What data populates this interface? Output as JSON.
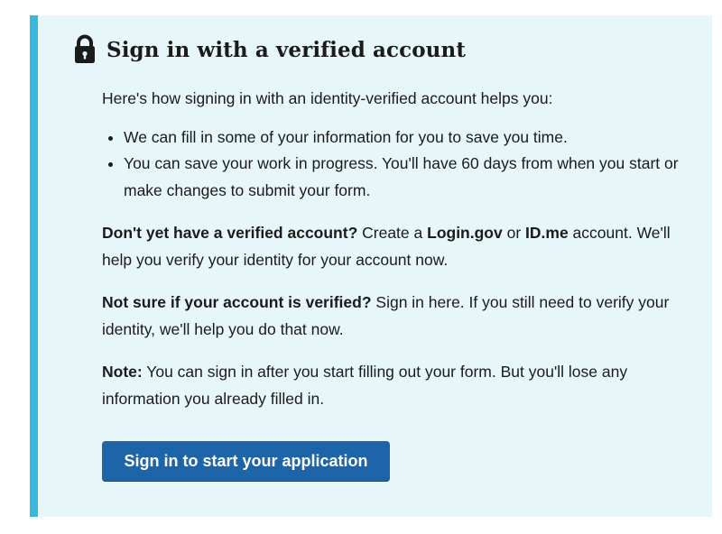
{
  "alert": {
    "heading": "Sign in with a verified account",
    "icon": "lock-icon",
    "intro": "Here's how signing in with an identity-verified account helps you:",
    "benefits": [
      "We can fill in some of your information for you to save you time.",
      "You can save your work in progress. You'll have 60 days from when you start or make changes to submit your form."
    ],
    "no_account": {
      "lead": "Don't yet have a verified account?",
      "text1": " Create a ",
      "login_gov": "Login.gov",
      "text2": " or ",
      "id_me": "ID.me",
      "text3": " account. We'll help you verify your identity for your account now."
    },
    "not_sure": {
      "lead": "Not sure if your account is verified?",
      "text": " Sign in here. If you still need to verify your identity, we'll help you do that now."
    },
    "note": {
      "lead": "Note:",
      "text": " You can sign in after you start filling out your form. But you'll lose any information you already filled in."
    },
    "button_label": "Sign in to start your application"
  },
  "colors": {
    "alert_background": "#e7f6f8",
    "alert_border": "#3bb6df",
    "button_background": "#1e64a8",
    "text": "#1b1b1b"
  }
}
